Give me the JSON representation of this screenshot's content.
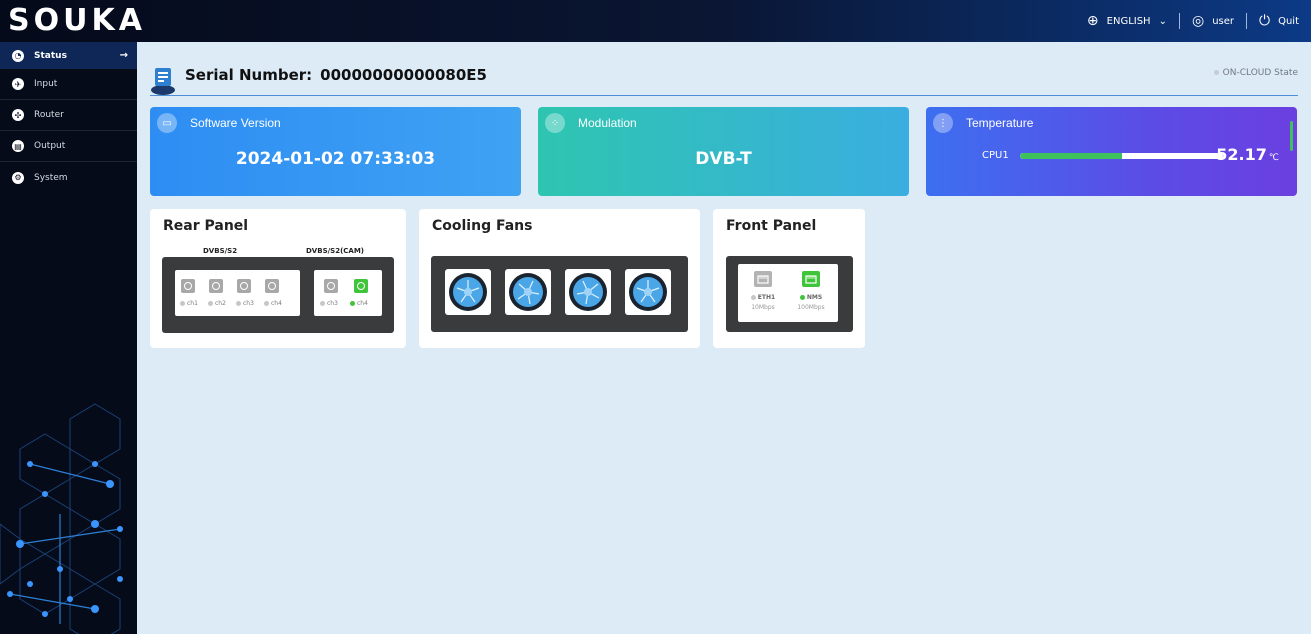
{
  "brand": {
    "logo": "SOUKA"
  },
  "topbar": {
    "language": "ENGLISH",
    "user": "user",
    "quit": "Quit"
  },
  "sidebar": {
    "items": [
      {
        "label": "Status",
        "icon": "status-icon",
        "active": true
      },
      {
        "label": "Input",
        "icon": "input-icon",
        "active": false
      },
      {
        "label": "Router",
        "icon": "router-icon",
        "active": false
      },
      {
        "label": "Output",
        "icon": "output-icon",
        "active": false
      },
      {
        "label": "System",
        "icon": "system-icon",
        "active": false
      }
    ]
  },
  "header": {
    "serial_label": "Serial Number:",
    "serial_value": "00000000000080E5",
    "cloud_state": "ON-CLOUD State"
  },
  "cards": {
    "software": {
      "title": "Software Version",
      "value": "2024-01-02 07:33:03"
    },
    "modulation": {
      "title": "Modulation",
      "value": "DVB-T"
    },
    "temperature": {
      "title": "Temperature",
      "cpu_label": "CPU1",
      "cpu_value": "52.17",
      "cpu_unit": "℃",
      "cpu_level": 0.5
    }
  },
  "rear_panel": {
    "title": "Rear Panel",
    "group1_label": "DVBS/S2",
    "group2_label": "DVBS/S2(CAM)",
    "group1": [
      {
        "label": "ch1",
        "on": false
      },
      {
        "label": "ch2",
        "on": false
      },
      {
        "label": "ch3",
        "on": false
      },
      {
        "label": "ch4",
        "on": false
      }
    ],
    "group2": [
      {
        "label": "ch3",
        "on": false
      },
      {
        "label": "ch4",
        "on": true
      }
    ]
  },
  "cooling_fans": {
    "title": "Cooling Fans",
    "count": 4
  },
  "front_panel": {
    "title": "Front Panel",
    "ports": [
      {
        "label": "ETH1",
        "speed": "10Mbps",
        "on": false
      },
      {
        "label": "NMS",
        "speed": "100Mbps",
        "on": true
      }
    ]
  },
  "colors": {
    "accent_blue": "#2e8df3",
    "ok_green": "#3fc43a",
    "sidebar_bg": "#050b18"
  }
}
